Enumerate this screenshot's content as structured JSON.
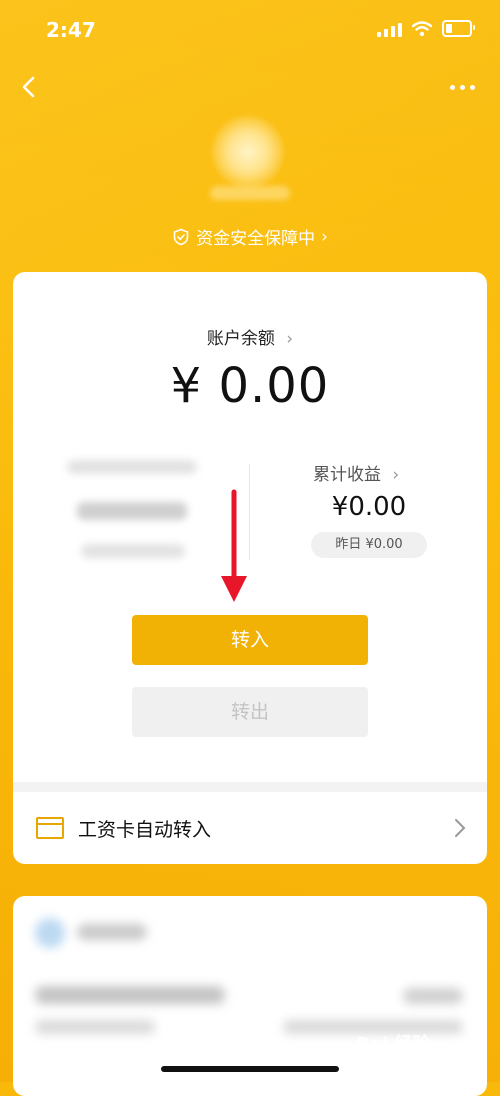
{
  "status": {
    "time": "2:47"
  },
  "security": {
    "label": "资金安全保障中",
    "chevron": "›"
  },
  "balance": {
    "label": "账户余额",
    "chevron": "›",
    "amount": "¥ 0.00"
  },
  "earnings": {
    "label": "累计收益",
    "chevron": "›",
    "amount": "¥0.00",
    "yesterday": "昨日 ¥0.00"
  },
  "actions": {
    "transfer_in": "转入",
    "transfer_out": "转出"
  },
  "salary": {
    "label": "工资卡自动转入"
  },
  "watermark": {
    "text": "Bai 经验"
  },
  "colors": {
    "accent": "#f1b105",
    "arrow": "#e8162a",
    "background": "#fbbd0d"
  },
  "icons": [
    "back-arrow-icon",
    "more-icon",
    "shield-icon",
    "chevron-right-icon",
    "card-icon",
    "red-arrow-down-icon"
  ]
}
